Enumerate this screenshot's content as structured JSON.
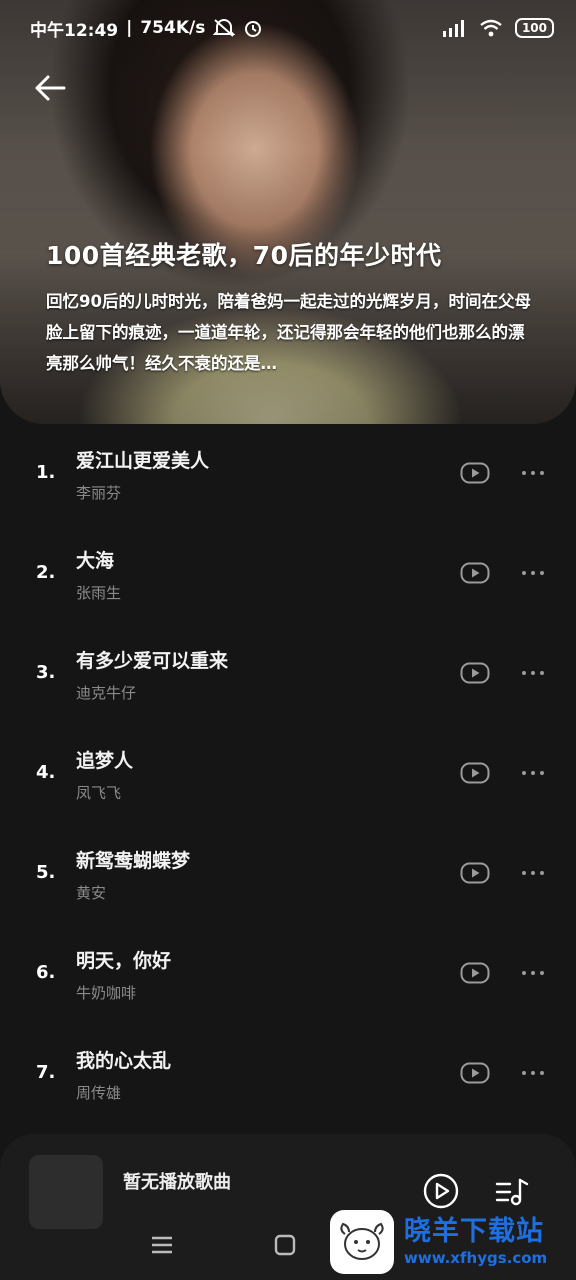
{
  "status_bar": {
    "time": "中午12:49",
    "speed": "754K/s",
    "battery": "100"
  },
  "playlist": {
    "title": "100首经典老歌，70后的年少时代",
    "description": "回忆90后的儿时时光，陪着爸妈一起走过的光辉岁月，时间在父母脸上留下的痕迹，一道道年轮，还记得那会年轻的他们也那么的漂亮那么帅气！经久不衰的还是…"
  },
  "songs": [
    {
      "index": "1.",
      "title": "爱江山更爱美人",
      "artist": "李丽芬"
    },
    {
      "index": "2.",
      "title": "大海",
      "artist": "张雨生"
    },
    {
      "index": "3.",
      "title": "有多少爱可以重来",
      "artist": "迪克牛仔"
    },
    {
      "index": "4.",
      "title": "追梦人",
      "artist": "凤飞飞"
    },
    {
      "index": "5.",
      "title": "新鸳鸯蝴蝶梦",
      "artist": "黄安"
    },
    {
      "index": "6.",
      "title": "明天，你好",
      "artist": "牛奶咖啡"
    },
    {
      "index": "7.",
      "title": "我的心太乱",
      "artist": "周传雄"
    }
  ],
  "player": {
    "now_playing": "暂无播放歌曲"
  },
  "watermark": {
    "title": "晓羊下载站",
    "url": "www.xfhygs.com"
  },
  "icons": {
    "back": "arrow-left-icon",
    "play": "play-circle-icon",
    "more": "more-dots-icon",
    "playlist": "music-list-icon"
  }
}
